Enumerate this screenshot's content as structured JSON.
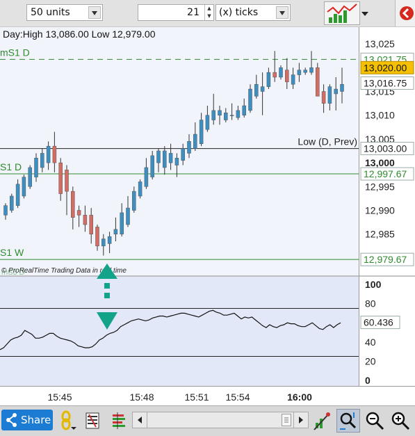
{
  "toolbar": {
    "units_value": "50 units",
    "ticks_value": "21",
    "ticks_unit": "(x) ticks"
  },
  "chart_data": [
    {
      "type": "candlestick",
      "title": "Day:High 13,086.00 Low 12,979.00",
      "ylim": [
        12977.5,
        13027.5
      ],
      "y_ticks": [
        "13,025",
        "13,020",
        "13,015",
        "13,010",
        "13,005",
        "13,000",
        "12,995",
        "12,990",
        "12,985"
      ],
      "x_ticks": [
        "15:45",
        "15:48",
        "15:51",
        "15:54",
        "16:00"
      ],
      "levels": [
        {
          "label": "mS1 D",
          "value": 13021.75,
          "price_label": "13,021.75",
          "style": "dashed",
          "color": "#2e8b2e"
        },
        {
          "label": "Low (D, Prev)",
          "value": 13003.0,
          "price_label": "13,003.00",
          "style": "solid",
          "color": "#222222"
        },
        {
          "label": "S1 D",
          "value": 12997.67,
          "price_label": "12,997.67",
          "style": "solid",
          "color": "#2e8b2e"
        },
        {
          "label": "S1 W",
          "value": 12979.67,
          "price_label": "12,979.67",
          "style": "solid",
          "color": "#2e8b2e"
        }
      ],
      "current_price": {
        "value": 13020.0,
        "label": "13,020.00",
        "color": "#f5c000"
      },
      "extra_price": {
        "value": 13016.75,
        "label": "13,016.75"
      },
      "candles": [
        [
          12989.0,
          12991.5,
          12988.0,
          12991.0
        ],
        [
          12990.0,
          12993.5,
          12989.5,
          12993.0
        ],
        [
          12991.0,
          12996.5,
          12990.5,
          12995.5
        ],
        [
          12993.0,
          12997.5,
          12992.5,
          12997.0
        ],
        [
          12995.0,
          12999.5,
          12994.5,
          12999.0
        ],
        [
          12997.0,
          13002.0,
          12996.0,
          13001.0
        ],
        [
          12999.0,
          13003.0,
          12998.0,
          13002.0
        ],
        [
          13000.0,
          13004.5,
          12998.5,
          13003.5
        ],
        [
          13003.5,
          13006.5,
          12998.0,
          13000.0
        ],
        [
          13000.0,
          13001.0,
          12992.0,
          12993.5
        ],
        [
          12998.5,
          12999.5,
          12989.0,
          12994.0
        ],
        [
          12994.0,
          12995.0,
          12986.0,
          12988.5
        ],
        [
          12990.0,
          12991.0,
          12986.5,
          12989.0
        ],
        [
          12989.0,
          12991.0,
          12985.5,
          12987.0
        ],
        [
          12989.0,
          12990.5,
          12983.0,
          12985.0
        ],
        [
          12986.5,
          12987.0,
          12981.5,
          12982.5
        ],
        [
          12982.5,
          12985.0,
          12980.5,
          12984.0
        ],
        [
          12983.0,
          12985.5,
          12981.0,
          12984.5
        ],
        [
          12985.0,
          12988.5,
          12983.5,
          12986.0
        ],
        [
          12985.0,
          12991.5,
          12984.5,
          12989.5
        ],
        [
          12987.0,
          12993.0,
          12986.5,
          12990.5
        ],
        [
          12990.0,
          12995.0,
          12989.5,
          12994.0
        ],
        [
          12993.0,
          12996.5,
          12992.5,
          12996.0
        ],
        [
          12995.0,
          13001.0,
          12994.5,
          12999.0
        ],
        [
          12997.0,
          13002.5,
          12996.5,
          13001.5
        ],
        [
          13000.0,
          13003.0,
          12998.0,
          13002.5
        ],
        [
          12999.0,
          13003.5,
          12997.5,
          13002.5
        ],
        [
          13000.0,
          13004.0,
          12998.5,
          13002.0
        ],
        [
          12999.5,
          13002.0,
          12997.0,
          13001.0
        ],
        [
          13000.5,
          13004.0,
          12999.5,
          13003.0
        ],
        [
          13002.0,
          13006.0,
          13001.0,
          13004.5
        ],
        [
          13003.0,
          13008.5,
          13002.5,
          13006.0
        ],
        [
          13004.0,
          13010.5,
          13003.5,
          13009.0
        ],
        [
          13007.0,
          13012.0,
          13006.5,
          13010.0
        ],
        [
          13009.0,
          13014.5,
          13008.0,
          13011.0
        ],
        [
          13010.0,
          13012.0,
          13008.0,
          13011.0
        ],
        [
          13009.0,
          13011.5,
          13008.5,
          13010.5
        ],
        [
          13010.0,
          13012.5,
          13009.0,
          13010.0
        ],
        [
          13009.5,
          13012.0,
          13009.0,
          13011.0
        ],
        [
          13010.0,
          13013.5,
          13009.5,
          13012.0
        ],
        [
          13011.0,
          13016.5,
          13010.5,
          13015.5
        ],
        [
          13014.0,
          13018.5,
          13013.5,
          13016.5
        ],
        [
          13015.0,
          13019.0,
          13010.0,
          13016.0
        ],
        [
          13016.0,
          13020.0,
          13015.5,
          13019.0
        ],
        [
          13019.0,
          13023.5,
          13017.0,
          13018.0
        ],
        [
          13018.0,
          13020.5,
          13017.5,
          13020.0
        ],
        [
          13019.5,
          13022.0,
          13015.5,
          13017.0
        ],
        [
          13016.5,
          13020.0,
          13015.5,
          13018.5
        ],
        [
          13018.5,
          13021.0,
          13017.0,
          13019.5
        ],
        [
          13019.0,
          13020.0,
          13018.5,
          13019.5
        ],
        [
          13019.0,
          13023.5,
          13018.5,
          13020.0
        ],
        [
          13020.0,
          13021.0,
          13014.0,
          13014.0
        ],
        [
          13015.0,
          13016.5,
          13010.5,
          13012.5
        ],
        [
          13012.5,
          13016.5,
          13011.0,
          13016.0
        ],
        [
          13014.5,
          13018.0,
          13011.0,
          13015.5
        ],
        [
          13015.0,
          13020.0,
          13012.5,
          13016.5
        ]
      ]
    },
    {
      "type": "line",
      "ylim": [
        0,
        100
      ],
      "y_ticks": [
        "100",
        "80",
        "60",
        "40",
        "20",
        "0"
      ],
      "guide_lines": [
        75,
        25
      ],
      "current_value": {
        "value": 60.436,
        "label": "60.436"
      },
      "values": [
        32,
        34,
        38,
        42,
        44,
        45,
        47,
        52,
        50,
        48,
        44,
        44,
        45,
        47,
        49,
        49,
        46,
        44,
        43,
        42,
        41,
        39,
        36,
        35,
        34,
        34,
        35,
        38,
        42,
        44,
        47,
        49,
        50,
        52,
        56,
        58,
        60,
        62,
        63,
        64,
        63,
        62,
        63,
        65,
        66,
        67,
        67,
        66,
        67,
        68,
        69,
        70,
        70,
        69,
        68,
        67,
        66,
        68,
        70,
        72,
        73,
        71,
        70,
        68,
        68,
        69,
        70,
        67,
        64,
        66,
        65,
        66,
        63,
        60,
        57,
        55,
        58,
        56,
        55,
        57,
        58,
        60,
        59,
        59,
        57,
        56,
        56,
        58,
        60,
        57,
        54,
        53,
        56,
        58,
        55,
        58,
        60
      ]
    }
  ],
  "watermark": "© ProRealTime Trading  Data in real time",
  "oscillator_label": "mS3 D",
  "bottom": {
    "share_label": "Share"
  },
  "colors": {
    "up": "#3d8fc2",
    "down": "#d36d64",
    "level": "#2e8b2e",
    "accent_arrow": "#12a38a"
  },
  "icons": [
    "chart-icon",
    "chevron-down-icon",
    "share-icon",
    "link-icon",
    "indicator-icon",
    "bars-icon",
    "scroll-left-icon",
    "scroll-right-icon",
    "drawing-tool-icon",
    "zoom-fit-icon",
    "zoom-out-icon",
    "zoom-in-icon",
    "red-arrow-icon"
  ]
}
